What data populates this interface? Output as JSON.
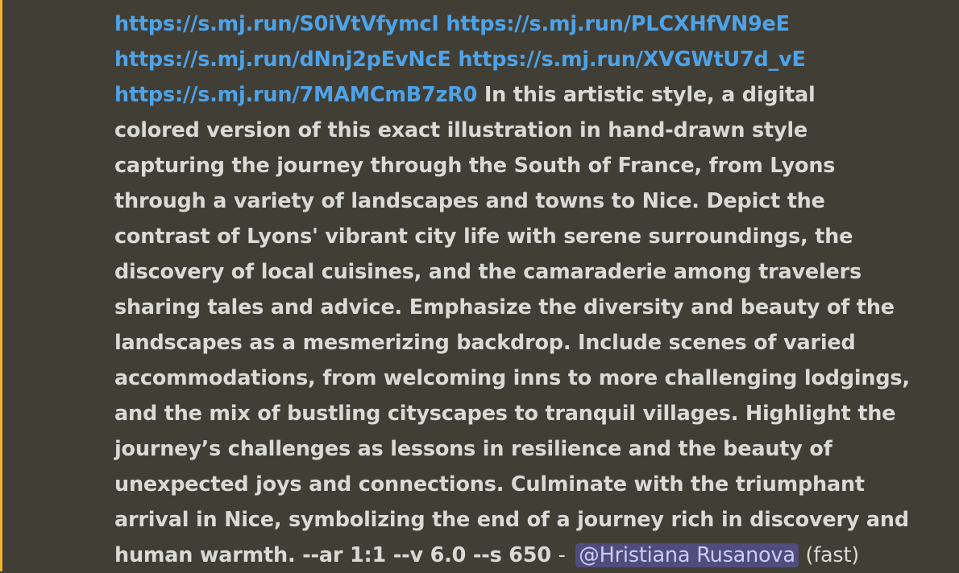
{
  "message": {
    "links": [
      "https://s.mj.run/S0iVtVfymcI",
      "https://s.mj.run/PLCXHfVN9eE",
      "https://s.mj.run/dNnj2pEvNcE",
      "https://s.mj.run/XVGWtU7d_vE",
      "https://s.mj.run/7MAMCmB7zR0"
    ],
    "prompt_lines": [
      "In this artistic style, a digital",
      "colored version of this exact illustration in hand-drawn style",
      "capturing the journey through the South of France, from Lyons",
      "through a variety of landscapes and towns to Nice. Depict the",
      "contrast of Lyons' vibrant city life with serene surroundings, the",
      "discovery of local cuisines, and the camaraderie among travelers",
      "sharing tales and advice. Emphasize the diversity and beauty of the",
      "landscapes as a mesmerizing backdrop. Include scenes of varied",
      "accommodations, from welcoming inns to more challenging lodgings,",
      "and the mix of bustling cityscapes to tranquil villages. Highlight the",
      "journey’s challenges as lessons in resilience and the beauty of",
      "unexpected joys and connections. Culminate with the triumphant",
      "arrival in Nice, symbolizing the end of a journey rich in discovery and",
      "human warmth. --ar 1:1 --v 6.0 --s 650"
    ],
    "separator": "-",
    "mention": "@Hristiana Rusanova",
    "speed": "(fast)"
  }
}
